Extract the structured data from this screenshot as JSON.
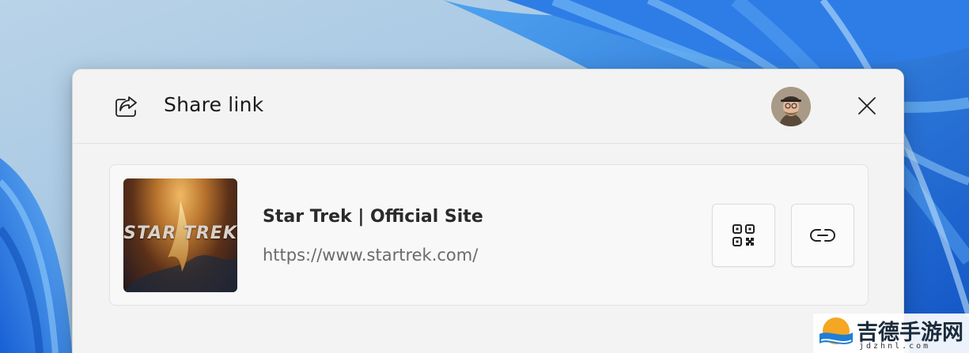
{
  "dialog": {
    "title": "Share link",
    "share_icon": "share-icon",
    "avatar_icon": "user-avatar",
    "close_icon": "close-icon"
  },
  "card": {
    "thumbnail_text": "STAR TREK",
    "site_title": "Star Trek | Official Site",
    "url": "https://www.startrek.com/",
    "qr_icon": "qr-code-icon",
    "copy_icon": "link-icon"
  },
  "watermark": {
    "text": "吉德手游网",
    "sub": "jdzhnl.com"
  },
  "colors": {
    "wallpaper": "#9fc6e6",
    "dialog_bg": "#f3f3f3",
    "card_bg": "#f8f8f8",
    "accent_blue": "#1e6fd9"
  }
}
